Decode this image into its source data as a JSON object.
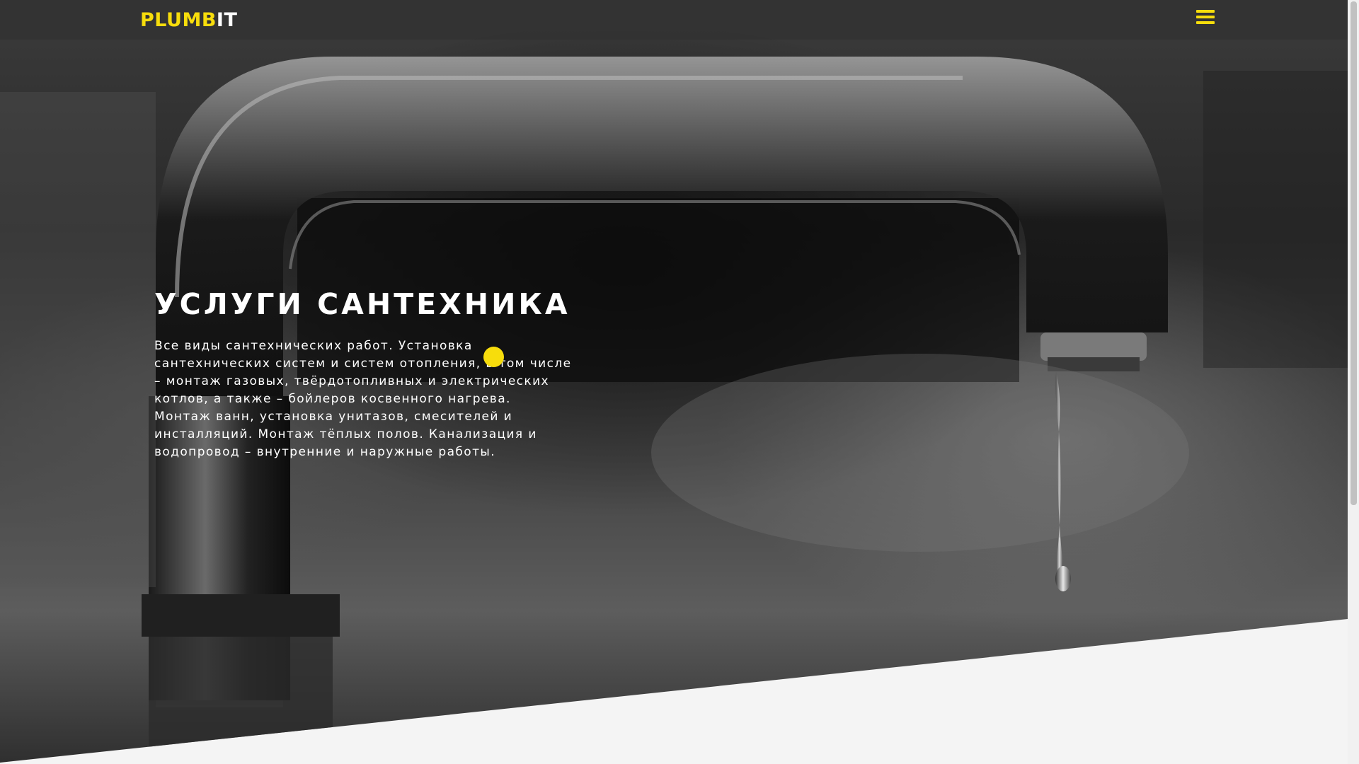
{
  "header": {
    "logo_accent": "PLUMB",
    "logo_rest": "IT",
    "menu_icon": "hamburger-icon",
    "accent_color": "#f7dd0c"
  },
  "hero": {
    "title": "УСЛУГИ САНТЕХНИКА",
    "description": "Все виды сантехнических работ. Установка сантехнических систем и систем отопления, в том числе – монтаж газовых, твёрдотопливных и электрических котлов, а также – бойлеров косвенного нагрева. Монтаж ванн, установка унитазов, смесителей и инсталляций. Монтаж тёплых полов. Канализация и водопровод – внутренние и наружные работы.",
    "background": "black-and-white faucet photo"
  }
}
